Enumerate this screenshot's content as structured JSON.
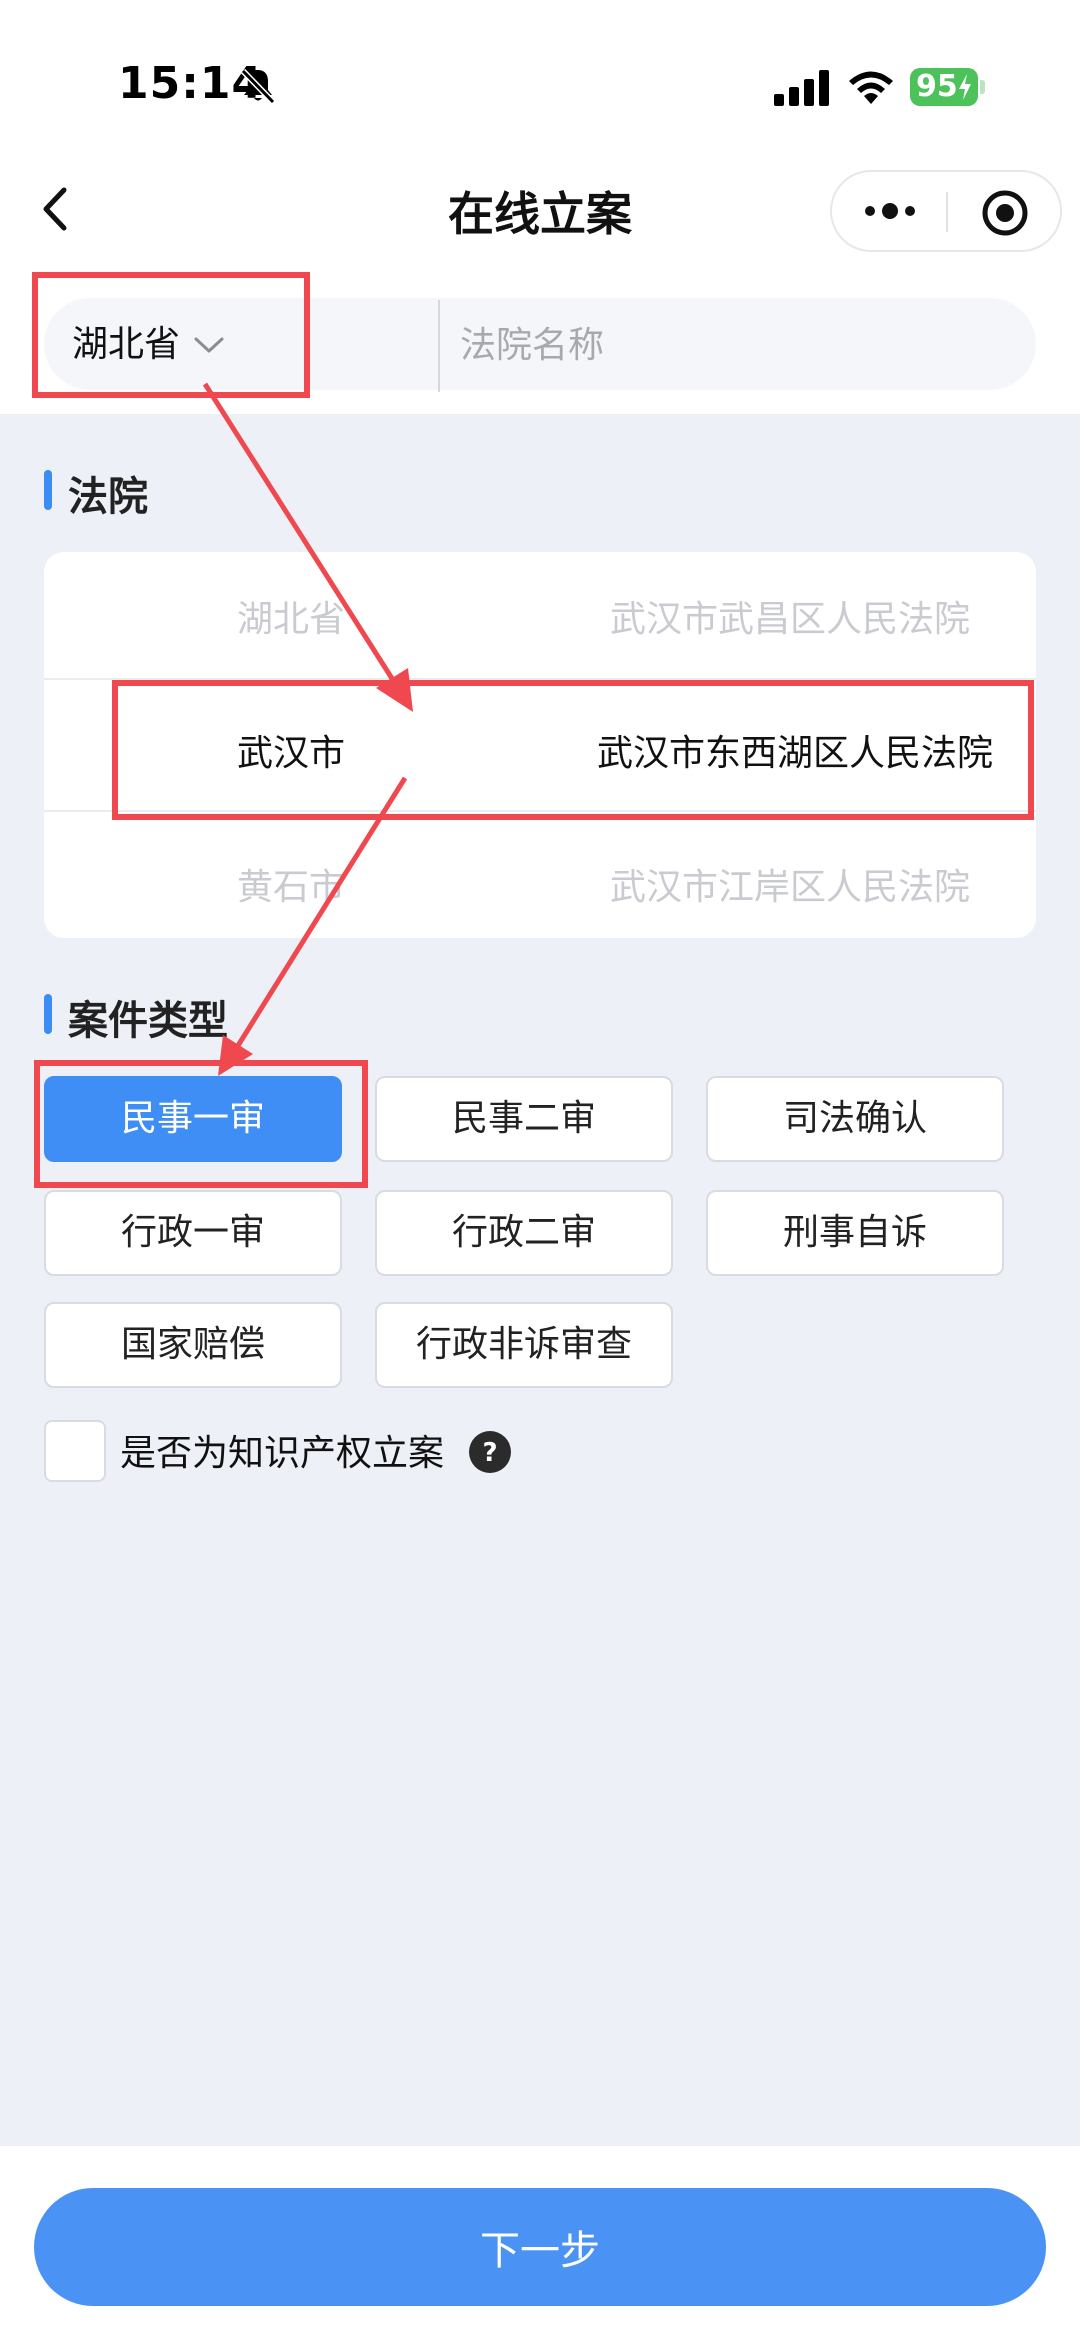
{
  "status_bar": {
    "time": "15:14",
    "battery": "95",
    "icons": [
      "bell-slash-icon",
      "signal-icon",
      "wifi-icon",
      "battery-icon"
    ]
  },
  "nav": {
    "title": "在线立案",
    "icons": [
      "back-icon",
      "more-icon",
      "target-icon"
    ]
  },
  "search": {
    "province": "湖北省",
    "placeholder": "法院名称"
  },
  "court_section": {
    "title": "法院",
    "rows": [
      {
        "city": "湖北省",
        "court": "武汉市武昌区人民法院"
      },
      {
        "city": "武汉市",
        "court": "武汉市东西湖区人民法院"
      },
      {
        "city": "黄石市",
        "court": "武汉市江岸区人民法院"
      }
    ],
    "selected_index": 1
  },
  "case_section": {
    "title": "案件类型",
    "types": [
      "民事一审",
      "民事二审",
      "司法确认",
      "行政一审",
      "行政二审",
      "刑事自诉",
      "国家赔偿",
      "行政非诉审查"
    ],
    "selected": "民事一审"
  },
  "ip_checkbox": {
    "label": "是否为知识产权立案",
    "checked": false
  },
  "next_button": "下一步",
  "colors": {
    "accent": "#3f8ef5",
    "annotation": "#f0484f",
    "background": "#eef0f7"
  }
}
